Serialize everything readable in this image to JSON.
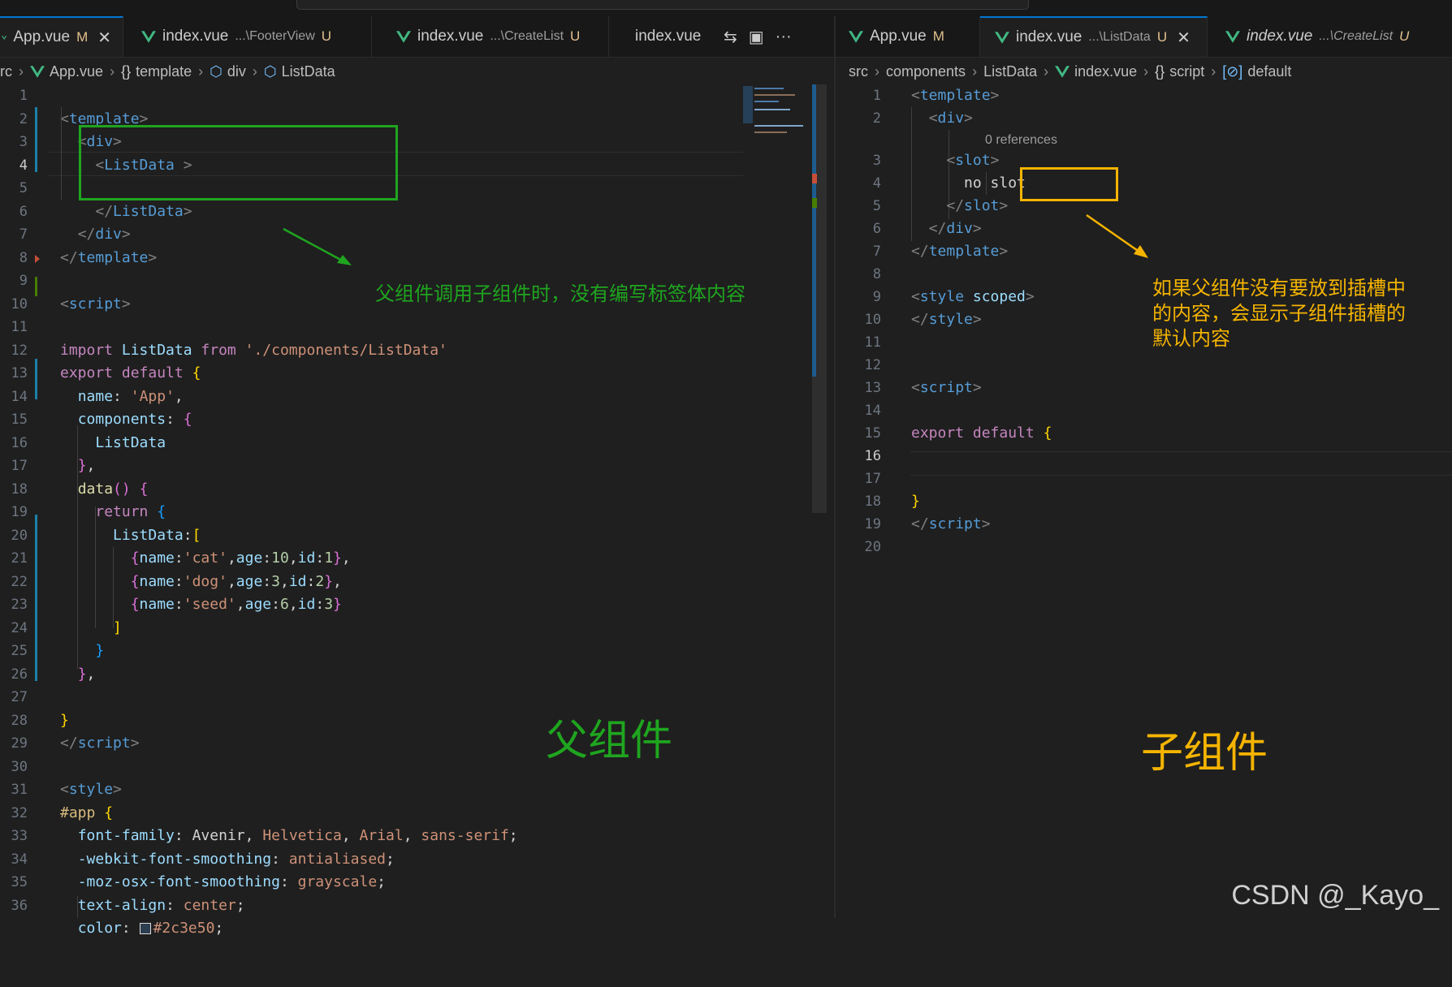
{
  "left_tabs": [
    {
      "name": "App.vue",
      "mark": "M",
      "close": "✕",
      "active": true
    },
    {
      "name": "index.vue",
      "desc": "...\\FooterView",
      "mark": "U"
    },
    {
      "name": "index.vue",
      "desc": "...\\CreateList",
      "mark": "U"
    },
    {
      "name": "index.vue"
    }
  ],
  "right_tabs": [
    {
      "name": "App.vue",
      "mark": "M"
    },
    {
      "name": "index.vue",
      "desc": "...\\ListData",
      "mark": "U",
      "close": "✕",
      "active": true
    },
    {
      "name": "index.vue",
      "desc": "...\\CreateList",
      "mark": "U"
    }
  ],
  "tab_actions": {
    "split_icon": "⇆",
    "layout_icon": "▣",
    "more": "···"
  },
  "left_breadcrumb": {
    "root": "rc",
    "file": "App.vue",
    "c1": "template",
    "c2": "div",
    "c3": "ListData"
  },
  "right_breadcrumb": {
    "root": "src",
    "c1": "components",
    "c2": "ListData",
    "file": "index.vue",
    "c3": "script",
    "c4": "default"
  },
  "left_code": {
    "l1": "1",
    "l2": "2",
    "l3": "3",
    "l4": "4",
    "l5": "5",
    "l6": "6",
    "l7": "7",
    "l8": "8",
    "l9": "9",
    "l10": "10",
    "l11": "11",
    "l12": "12",
    "l13": "13",
    "l14": "14",
    "l15": "15",
    "l16": "16",
    "l17": "17",
    "l18": "18",
    "l19": "19",
    "l20": "20",
    "l21": "21",
    "l22": "22",
    "l23": "23",
    "l24": "24",
    "l25": "25",
    "l26": "26",
    "l27": "27",
    "l28": "28",
    "l29": "29",
    "l30": "30",
    "l31": "31",
    "l32": "32",
    "l33": "33",
    "l34": "34",
    "l35": "35",
    "l36": "36",
    "template_open": "template",
    "div": "div",
    "listdata": "ListData",
    "script": "script",
    "import_kw": "import",
    "import_name": "ListData",
    "from_kw": "from",
    "import_path": "'./components/ListData'",
    "export_kw": "export",
    "default_kw": "default",
    "name_key": "name",
    "name_val": "'App'",
    "components_key": "components",
    "listdata_comp": "ListData",
    "data_fn": "data",
    "return_kw": "return",
    "listdata_key": "ListData",
    "row1_name": "'cat'",
    "row1_age": "10",
    "row1_id": "1",
    "row2_name": "'dog'",
    "row2_age": "3",
    "row2_id": "2",
    "row3_name": "'seed'",
    "row3_age": "6",
    "row3_id": "3",
    "style": "style",
    "app_sel": "#app",
    "ff_key": "font-family",
    "ff_1": "Avenir",
    "ff_2": "Helvetica",
    "ff_3": "Arial",
    "ff_4": "sans-serif",
    "wfs_key": "-webkit-font-smoothing",
    "wfs_val": "antialiased",
    "mfs_key": "-moz-osx-font-smoothing",
    "mfs_val": "grayscale",
    "ta_key": "text-align",
    "ta_val": "center",
    "color_key": "color",
    "color_val": "#2c3e50",
    "name_word": "name",
    "age_word": "age",
    "id_word": "id"
  },
  "right_code": {
    "l1": "1",
    "l2": "2",
    "l3": "3",
    "l4": "4",
    "l5": "5",
    "l6": "6",
    "l7": "7",
    "l8": "8",
    "l9": "9",
    "l10": "10",
    "l11": "11",
    "l12": "12",
    "l13": "13",
    "l14": "14",
    "l15": "15",
    "l16": "16",
    "l17": "17",
    "l18": "18",
    "l19": "19",
    "l20": "20",
    "template": "template",
    "div": "div",
    "refs": "0 references",
    "slot": "slot",
    "slot_content": "no slot",
    "style": "style",
    "scoped": "scoped",
    "script": "script",
    "export_kw": "export",
    "default_kw": "default"
  },
  "annotations": {
    "left_note": "父组件调用子组件时，没有编写标签体内容",
    "left_label": "父组件",
    "right_note_1": "如果父组件没有要放到插槽中",
    "right_note_2": "的内容，会显示子组件插槽的",
    "right_note_3": "默认内容",
    "right_label": "子组件",
    "green": "#1fa51f",
    "yellow": "#f5b400"
  },
  "watermark": "CSDN @_Kayo_"
}
